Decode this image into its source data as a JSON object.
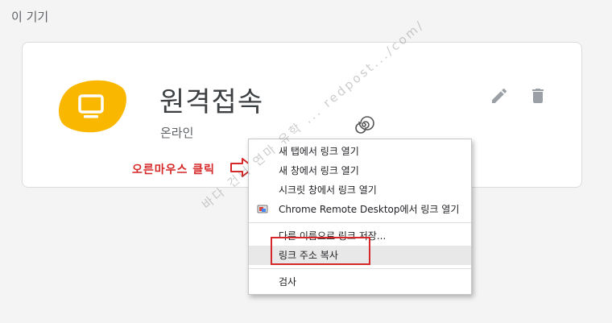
{
  "section": {
    "title": "이 기기"
  },
  "device": {
    "name": "원격접속",
    "status": "온라인"
  },
  "icons": {
    "device": "monitor-icon",
    "edit": "pencil-icon",
    "delete": "trash-icon",
    "remote_desktop": "chrome-remote-desktop-icon"
  },
  "colors": {
    "accent_blob": "#f9b700",
    "annotation": "#d62828"
  },
  "annotation": {
    "text": "오른마우스 클릭"
  },
  "watermark": {
    "text": "바다 건너 연마 유학 ... redpost.../com/"
  },
  "context_menu": {
    "items": [
      {
        "label": "새 탭에서 링크 열기"
      },
      {
        "label": "새 창에서 링크 열기"
      },
      {
        "label": "시크릿 창에서 링크 열기"
      },
      {
        "label": "Chrome Remote Desktop에서 링크 열기"
      },
      {
        "label": "다른 이름으로 링크 저장..."
      },
      {
        "label": "링크 주소 복사"
      },
      {
        "label": "검사"
      }
    ]
  }
}
